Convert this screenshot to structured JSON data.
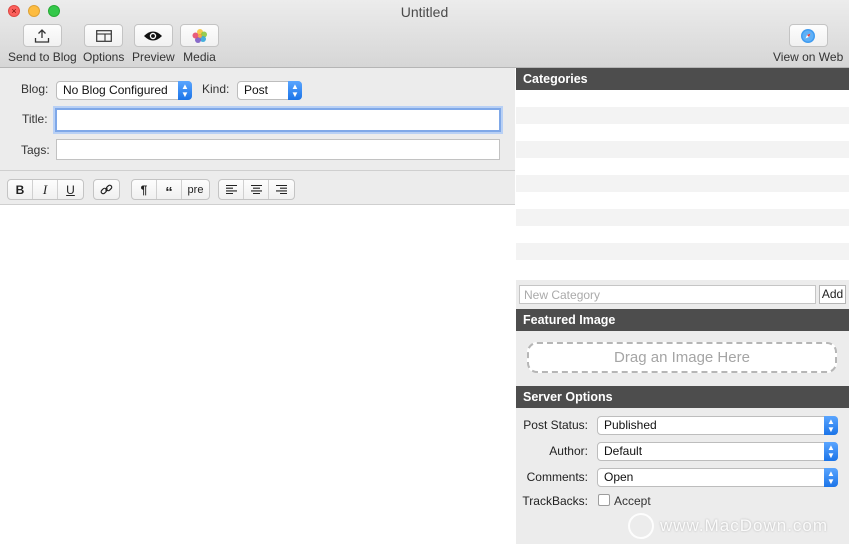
{
  "window": {
    "title": "Untitled"
  },
  "toolbar": {
    "send_label": "Send to Blog",
    "options_label": "Options",
    "preview_label": "Preview",
    "media_label": "Media",
    "view_web_label": "View on Web"
  },
  "meta": {
    "blog_label": "Blog:",
    "blog_value": "No Blog Configured",
    "kind_label": "Kind:",
    "kind_value": "Post",
    "title_label": "Title:",
    "title_value": "",
    "tags_label": "Tags:",
    "tags_value": ""
  },
  "format_bar": {
    "bold": "B",
    "italic": "I",
    "underline": "U",
    "paragraph": "¶",
    "quote": "“",
    "pre": "pre"
  },
  "categories": {
    "heading": "Categories",
    "new_placeholder": "New Category",
    "add_label": "Add"
  },
  "featured": {
    "heading": "Featured Image",
    "drop_text": "Drag an Image Here"
  },
  "server": {
    "heading": "Server Options",
    "status_label": "Post Status:",
    "status_value": "Published",
    "author_label": "Author:",
    "author_value": "Default",
    "comments_label": "Comments:",
    "comments_value": "Open",
    "trackbacks_label": "TrackBacks:",
    "accept_label": "Accept",
    "accept_checked": false
  },
  "watermark": "www.MacDown.com"
}
